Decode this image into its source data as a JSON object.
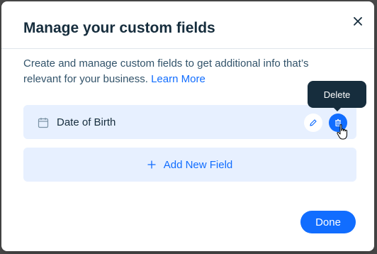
{
  "modal": {
    "title": "Manage your custom fields",
    "description": "Create and manage custom fields to get additional info that’s relevant for your business. ",
    "learn_more_label": "Learn More"
  },
  "fields": [
    {
      "label": "Date of Birth",
      "icon": "calendar-icon"
    }
  ],
  "actions": {
    "edit_icon": "pencil-icon",
    "delete_icon": "trash-icon",
    "delete_tooltip": "Delete"
  },
  "add_field_label": "Add New Field",
  "done_label": "Done",
  "colors": {
    "accent": "#116dff",
    "row_bg": "#e7f0ff",
    "title": "#162d3d",
    "text": "#32536a",
    "tooltip_bg": "#162d3d"
  }
}
